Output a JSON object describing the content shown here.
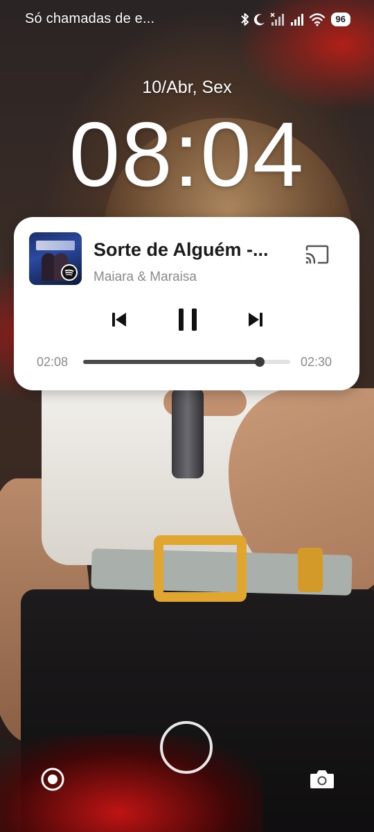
{
  "status_bar": {
    "carrier_text": "Só chamadas de e...",
    "icons": [
      "bluetooth-icon",
      "moon-icon",
      "no-signal-icon",
      "signal-icon",
      "wifi-icon",
      "battery-icon"
    ],
    "battery_level": "96"
  },
  "lock_screen": {
    "date": "10/Abr, Sex",
    "time": "08:04"
  },
  "media_player": {
    "track_title": "Sorte de Alguém -...",
    "artist": "Maiara & Maraisa",
    "source_app_icon": "spotify-icon",
    "cast_icon": "cast-icon",
    "controls": [
      "previous-icon",
      "pause-icon",
      "next-icon"
    ],
    "elapsed": "02:08",
    "duration": "02:30",
    "progress_fraction": 0.853
  },
  "bottom_shortcuts": {
    "left_icon": "record-icon",
    "center_icon": "unlock-ring-icon",
    "right_icon": "camera-icon"
  },
  "colors": {
    "card_background": "#ffffff",
    "progress_fill": "#4a4a4a",
    "progress_track": "#e2e2e2",
    "spotify_green": "#1db954"
  }
}
